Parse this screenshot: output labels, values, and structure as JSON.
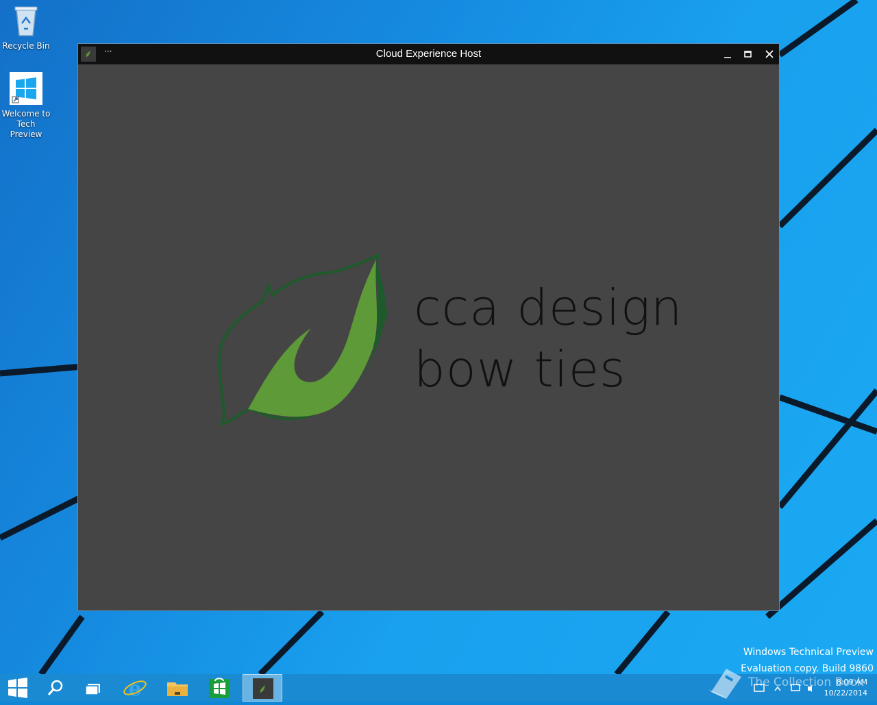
{
  "desktop": {
    "icons": [
      {
        "label": "Recycle Bin",
        "icon": "recycle-bin-icon"
      },
      {
        "label_line1": "Welcome to",
        "label_line2": "Tech Preview",
        "icon": "windows-logo-icon"
      }
    ],
    "watermark": {
      "line1": "Windows Technical Preview",
      "line2": "Evaluation copy. Build 9860",
      "overlay": "The Collection Book"
    }
  },
  "window": {
    "title": "Cloud Experience Host",
    "menu_glyph": "···",
    "brand": {
      "line1": "cca design",
      "line2": "bow ties"
    },
    "colors": {
      "background": "#454545",
      "leaf_light": "#5e9a38",
      "leaf_dark": "#1f5a2d"
    }
  },
  "taskbar": {
    "buttons": [
      {
        "icon": "start-icon"
      },
      {
        "icon": "search-icon"
      },
      {
        "icon": "task-view-icon"
      },
      {
        "icon": "internet-explorer-icon"
      },
      {
        "icon": "file-explorer-icon"
      },
      {
        "icon": "store-icon"
      },
      {
        "icon": "cloud-experience-host-icon",
        "active": true
      }
    ],
    "clock": {
      "time": "8:09 AM",
      "date": "10/22/2014"
    }
  }
}
